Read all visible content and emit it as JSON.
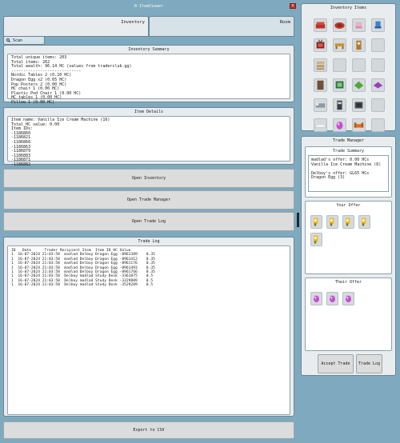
{
  "window": {
    "title": "B-ItemViewer"
  },
  "tabs": [
    {
      "label": "Inventory"
    },
    {
      "label": "Room"
    }
  ],
  "scan": {
    "label": "Scan"
  },
  "inventory_summary": {
    "title": "Inventory Summary",
    "lines": [
      "Total unique items: 203",
      "Total items: 262",
      "Total wealth: 96.14 HC (values from traderclub.gg)",
      "-----------------------------",
      "Nordic Tables 2 (0.10 HC)",
      "Dragon Egg x2 (0.65 HC)",
      "Pop Posters 2 (0.00 HC)",
      "HC chair 1 (0.00 HC)",
      "Plastic Pod Chair 1 (0.00 HC)",
      "HC tables 1 (0.00 HC)",
      "Pillow 1 (0.00 HC)"
    ]
  },
  "item_details": {
    "title": "Item Details",
    "lines": [
      "Item name: Vanilla Ice Cream Machine (16)",
      "Total HC value: 0.00",
      "Item IDs:",
      "-1186860",
      "-1186821",
      "-1186866",
      "-1186863",
      "-1186879",
      "-1186883",
      "-1186871",
      "-1186882"
    ]
  },
  "buttons": {
    "open_inventory": "Open Inventory",
    "open_trade_manager": "Open Trade Manager",
    "open_trade_log": "Open Trade Log",
    "export_csv": "Export to CSV",
    "accept_trade": "Accept Trade",
    "trade_log": "Trade Log"
  },
  "trade_log": {
    "title": "Trade Log",
    "columns": [
      "ID",
      "Date",
      "Trader",
      "Recipient",
      "Item",
      "Item ID",
      "HC Value"
    ],
    "rows": [
      [
        "1",
        "16-07-2024 21:03:58",
        "madlad",
        "Delboy",
        "Dragon Egg",
        "-8961389",
        "0.35"
      ],
      [
        "1",
        "16-07-2024 21:03:58",
        "madlad",
        "Delboy",
        "Dragon Egg",
        "-8961412",
        "0.35"
      ],
      [
        "1",
        "16-07-2024 21:03:58",
        "madlad",
        "Delboy",
        "Dragon Egg",
        "-8961176",
        "0.35"
      ],
      [
        "1",
        "16-07-2024 21:03:58",
        "madlad",
        "Delboy",
        "Dragon Egg",
        "-8961493",
        "0.35"
      ],
      [
        "1",
        "16-07-2024 21:03:58",
        "madlad",
        "Delboy",
        "Dragon Egg",
        "-8961766",
        "0.35"
      ],
      [
        "1",
        "16-07-2024 21:03:58",
        "Delboy",
        "madlad",
        "Study Desk",
        "-3361875",
        "0.5"
      ],
      [
        "1",
        "16-07-2024 21:03:58",
        "Delboy",
        "madlad",
        "Study Desk",
        "-3329809",
        "0.5"
      ],
      [
        "1",
        "16-07-2024 21:03:58",
        "Delboy",
        "madlad",
        "Study Desk",
        "-3529209",
        "0.5"
      ]
    ]
  },
  "inventory_items": {
    "title": "Inventory Items",
    "icons": [
      "red-sofa-icon",
      "red-rug-icon",
      "pink-chair-icon",
      "blue-chair-icon",
      "tv-icon",
      "wooden-table-icon",
      "clock-icon",
      "empty",
      "stacked-boxes-icon",
      "empty",
      "empty",
      "empty",
      "brown-panel-icon",
      "green-screen-icon",
      "green-plant-icon",
      "purple-rug-icon",
      "grey-bed-icon",
      "dark-cabinet-icon",
      "dark-crate-icon",
      "empty",
      "white-bed-icon",
      "purple-egg-icon",
      "orange-couch-icon",
      "empty"
    ]
  },
  "trade_manager": {
    "title": "Trade Manager",
    "summary_title": "Trade Summary",
    "summary_lines": [
      "madlad's offer: 0.00 HCs",
      "Vanilla Ice Cream Machine (6)",
      "",
      "Delboy's offer: GL65 HCs",
      "Dragon Egg (3)"
    ],
    "your_offer_title": "Your Offer",
    "their_offer_title": "Their Offer"
  },
  "colors": {
    "background": "#7fa9be",
    "panel": "#e9ecee",
    "close": "#c0392b"
  }
}
